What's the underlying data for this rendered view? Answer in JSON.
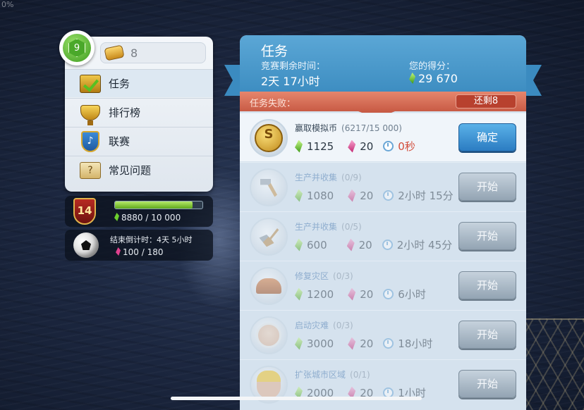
{
  "corner_text": "0%",
  "player": {
    "level": "9",
    "coins": "8"
  },
  "menu": [
    {
      "label": "任务",
      "icon": "tasks-icon"
    },
    {
      "label": "排行榜",
      "icon": "trophy-icon"
    },
    {
      "label": "联赛",
      "icon": "league-icon"
    },
    {
      "label": "常见问题",
      "icon": "faq-icon"
    }
  ],
  "rank": {
    "badge": "14",
    "xp_text": "8880 / 10 000",
    "xp_fraction": 0.888
  },
  "event": {
    "countdown": "结束倒计时：4天 5小时",
    "gems_text": "100 / 180"
  },
  "panel": {
    "title": "任务",
    "time_label": "竞赛剩余时间：",
    "time_value": "2天 17小时",
    "score_label": "您的得分：",
    "score_value": "29 670",
    "failed_label": "任务失败：",
    "remaining": "还剩8"
  },
  "tasks": [
    {
      "name": "赢取模拟币",
      "progress": "(6217/15 000)",
      "green": "1125",
      "pink": "20",
      "time": "0秒",
      "button": "确定",
      "state": "active",
      "icon": "coin-icon",
      "icon_text": "S"
    },
    {
      "name": "生产并收集",
      "progress": "(0/9)",
      "green": "1080",
      "pink": "20",
      "time": "2小时 15分",
      "button": "开始",
      "state": "dim",
      "icon": "hammer-icon",
      "icon_text": ""
    },
    {
      "name": "生产并收集",
      "progress": "(0/5)",
      "green": "600",
      "pink": "20",
      "time": "2小时 45分",
      "button": "开始",
      "state": "dim",
      "icon": "shovel-icon",
      "icon_text": ""
    },
    {
      "name": "修复灾区",
      "progress": "(0/3)",
      "green": "1200",
      "pink": "20",
      "time": "6小时",
      "button": "开始",
      "state": "dim",
      "icon": "helmet-icon",
      "icon_text": ""
    },
    {
      "name": "启动灾难",
      "progress": "(0/3)",
      "green": "3000",
      "pink": "20",
      "time": "18小时",
      "button": "开始",
      "state": "dim",
      "icon": "scientist-icon",
      "icon_text": ""
    },
    {
      "name": "扩张城市区域",
      "progress": "(0/1)",
      "green": "2000",
      "pink": "20",
      "time": "1小时",
      "button": "开始",
      "state": "dim",
      "icon": "worker-icon",
      "icon_text": ""
    }
  ],
  "colors": {
    "accent_blue": "#3d8dc1",
    "fail_red": "#c85b45",
    "gem_green": "#3e9a16",
    "gem_pink": "#c2236f",
    "time_red": "#d24c3a"
  }
}
